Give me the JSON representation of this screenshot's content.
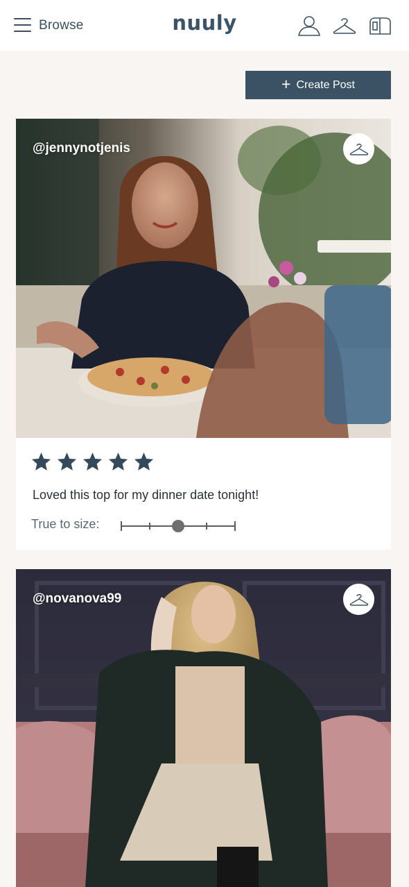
{
  "header": {
    "menu_label": "Browse",
    "logo": "nuuly",
    "icons": [
      "user-icon",
      "hanger-icon",
      "bag-icon"
    ]
  },
  "actions": {
    "create_post_label": "Create Post",
    "create_post_icon": "plus-icon"
  },
  "colors": {
    "brand": "#3b5264",
    "background": "#f8f5f2",
    "star": "#34495a"
  },
  "posts": [
    {
      "username": "@jennynotjenis",
      "rating": 5,
      "max_rating": 5,
      "review": "Loved this top for my dinner date tonight!",
      "fit_label": "True to size:",
      "fit_value": 0.5
    },
    {
      "username": "@novanova99"
    }
  ]
}
